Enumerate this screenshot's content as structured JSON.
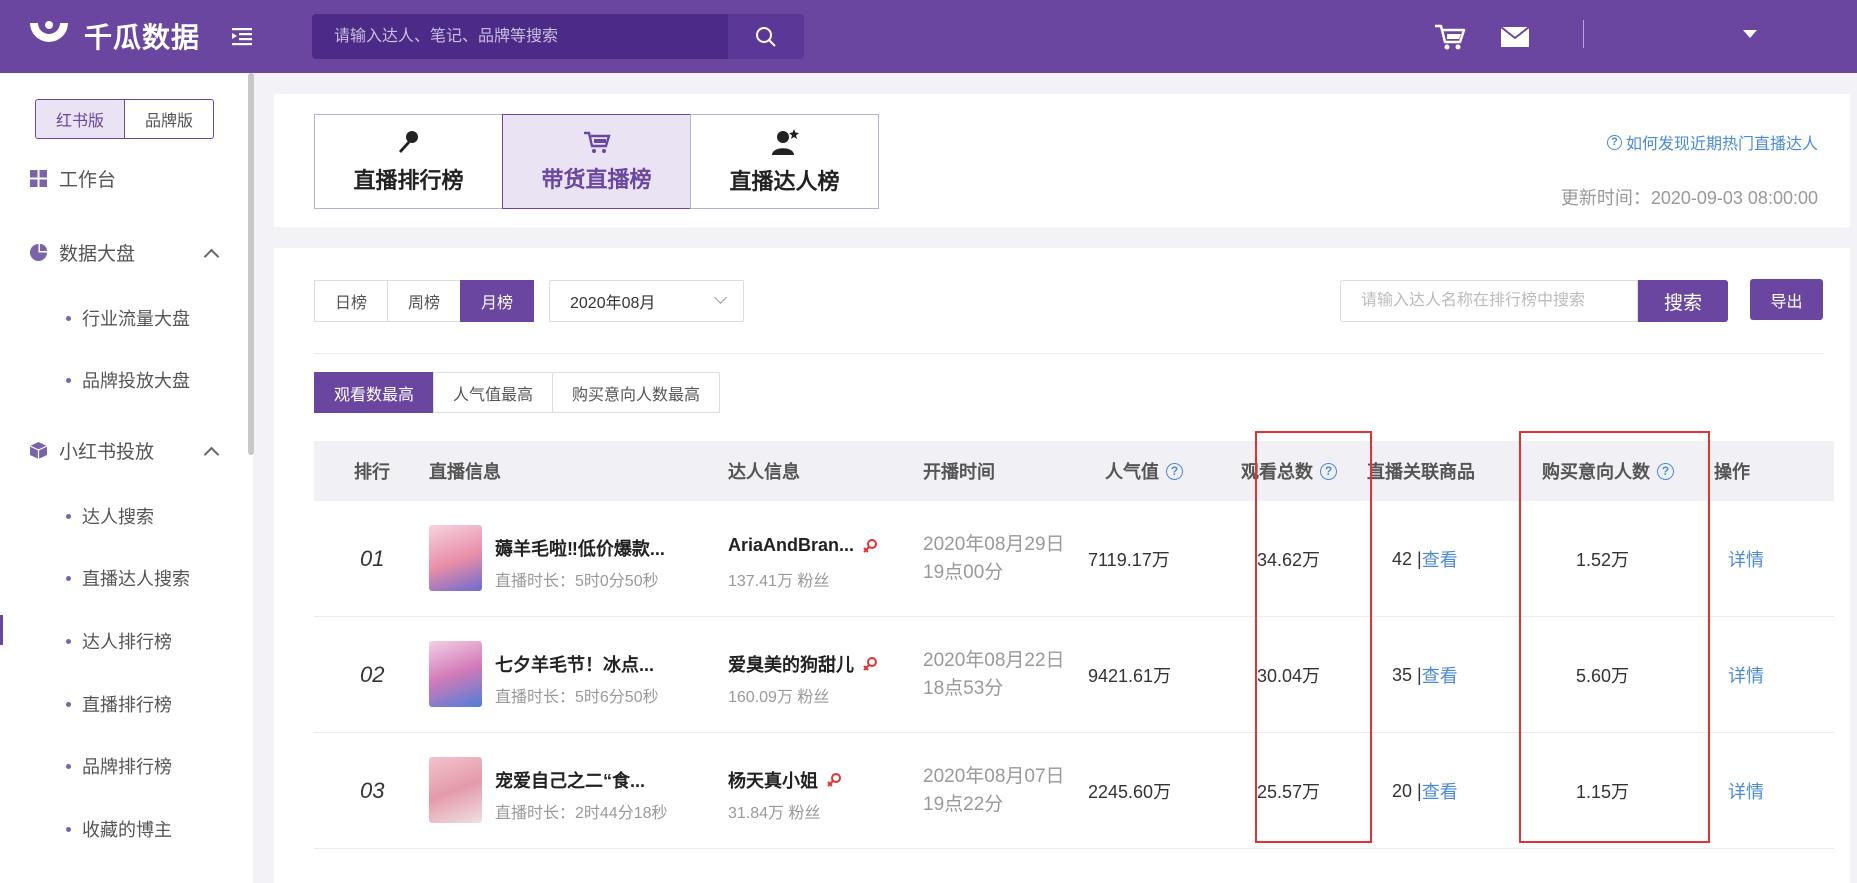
{
  "header": {
    "logo_text": "千瓜数据",
    "search_placeholder": "请输入达人、笔记、品牌等搜索"
  },
  "sidebar": {
    "version_tabs": [
      "红书版",
      "品牌版"
    ],
    "workbench": "工作台",
    "data_dashboard": "数据大盘",
    "data_dashboard_items": [
      "行业流量大盘",
      "品牌投放大盘"
    ],
    "xhs_delivery": "小红书投放",
    "xhs_items": [
      "达人搜索",
      "直播达人搜索",
      "达人排行榜",
      "直播排行榜",
      "品牌排行榜",
      "收藏的博主"
    ]
  },
  "rank_tabs": [
    {
      "label": "直播排行榜",
      "icon": "microphone-icon"
    },
    {
      "label": "带货直播榜",
      "icon": "cart-icon"
    },
    {
      "label": "直播达人榜",
      "icon": "person-star-icon"
    }
  ],
  "help_link": "如何发现近期热门直播达人",
  "update_time": "更新时间：2020-09-03 08:00:00",
  "filters": {
    "period_tabs": [
      "日榜",
      "周榜",
      "月榜"
    ],
    "month": "2020年08月",
    "kol_search_placeholder": "请输入达人名称在排行榜中搜索",
    "search_label": "搜索",
    "export_label": "导出",
    "sort_tabs": [
      "观看数最高",
      "人气值最高",
      "购买意向人数最高"
    ]
  },
  "table": {
    "headers": {
      "rank": "排行",
      "live_info": "直播信息",
      "kol_info": "达人信息",
      "start_time": "开播时间",
      "popularity": "人气值",
      "views": "观看总数",
      "goods": "直播关联商品",
      "buyers": "购买意向人数",
      "ops": "操作"
    },
    "view_label": "查看",
    "detail_label": "详情",
    "rows": [
      {
        "rank": "01",
        "title": "薅羊毛啦‼低价爆款...",
        "duration": "直播时长：5时0分50秒",
        "kol": "AriaAndBran...",
        "fans": "137.41万 粉丝",
        "date": "2020年08月29日",
        "time": "19点00分",
        "popularity": "7119.17万",
        "views": "34.62万",
        "goods": "42 | ",
        "buyers": "1.52万",
        "thumb_color": "#f0b8c8"
      },
      {
        "rank": "02",
        "title": "七夕羊毛节！冰点...",
        "duration": "直播时长：5时6分50秒",
        "kol": "爱臭美的狗甜儿",
        "fans": "160.09万 粉丝",
        "date": "2020年08月22日",
        "time": "18点53分",
        "popularity": "9421.61万",
        "views": "30.04万",
        "goods": "35 | ",
        "buyers": "5.60万",
        "thumb_color": "#c8a0d8"
      },
      {
        "rank": "03",
        "title": "宠爱自己之二“食...",
        "duration": "直播时长：2时44分18秒",
        "kol": "杨天真小姐",
        "fans": "31.84万 粉丝",
        "date": "2020年08月07日",
        "time": "19点22分",
        "popularity": "2245.60万",
        "views": "25.57万",
        "goods": "20 | ",
        "buyers": "1.15万",
        "thumb_color": "#e8a8b4"
      }
    ]
  }
}
